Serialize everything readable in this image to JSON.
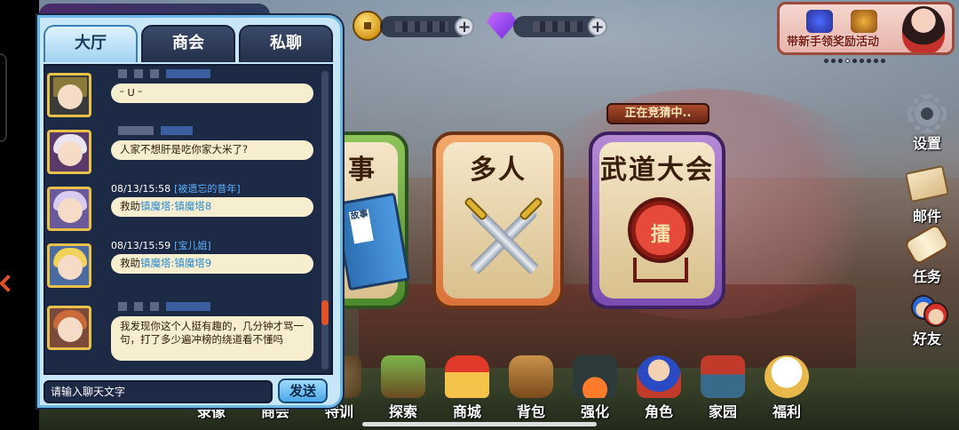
{
  "currency": {
    "coin_icon": "gold-coin-icon",
    "gem_icon": "purple-diamond-icon",
    "plus": "+"
  },
  "promo": {
    "label": "带新手领奖励活动",
    "dots_count_shown": 9
  },
  "modes": {
    "left_title": "事",
    "left_book_label": "故事",
    "multiplayer_title": "多人",
    "tournament_title": "武道大会",
    "tournament_status": "正在竞猜中..",
    "tournament_drum_label": "擂"
  },
  "side_menu": [
    {
      "label": "设置",
      "icon": "gear-icon"
    },
    {
      "label": "邮件",
      "icon": "envelope-icon"
    },
    {
      "label": "任务",
      "icon": "scroll-icon"
    },
    {
      "label": "好友",
      "icon": "friends-icon"
    }
  ],
  "bottom_menu": [
    {
      "label": "录像",
      "icon": "record-icon"
    },
    {
      "label": "商会",
      "icon": "guild-icon"
    },
    {
      "label": "特训",
      "icon": "training-icon"
    },
    {
      "label": "探索",
      "icon": "explore-icon"
    },
    {
      "label": "商城",
      "icon": "shop-icon"
    },
    {
      "label": "背包",
      "icon": "backpack-icon"
    },
    {
      "label": "强化",
      "icon": "forge-icon"
    },
    {
      "label": "角色",
      "icon": "character-icon"
    },
    {
      "label": "家园",
      "icon": "home-icon"
    },
    {
      "label": "福利",
      "icon": "welfare-icon"
    }
  ],
  "chat": {
    "tabs": [
      "大厅",
      "商会",
      "私聊"
    ],
    "active_tab": "大厅",
    "messages": [
      {
        "time": "",
        "sender": "",
        "text": "ᵕ ᑌ ᵕ"
      },
      {
        "time": "",
        "sender": "",
        "text": "人家不想肝是吃你家大米了?"
      },
      {
        "time": "08/13/15:58",
        "sender": "[被遗忘的昔年]",
        "prefix": "救助",
        "link": "镇魔塔:镇魔塔8"
      },
      {
        "time": "08/13/15:59",
        "sender": "[宝儿姐]",
        "prefix": "救助",
        "link": "镇魔塔:镇魔塔9"
      },
      {
        "time": "",
        "sender": "",
        "text": "我发现你这个人挺有趣的，几分钟才骂一句，打了多少遍冲榜的绕道看不懂吗"
      }
    ],
    "input_placeholder": "请输入聊天文字",
    "send_label": "发送"
  }
}
